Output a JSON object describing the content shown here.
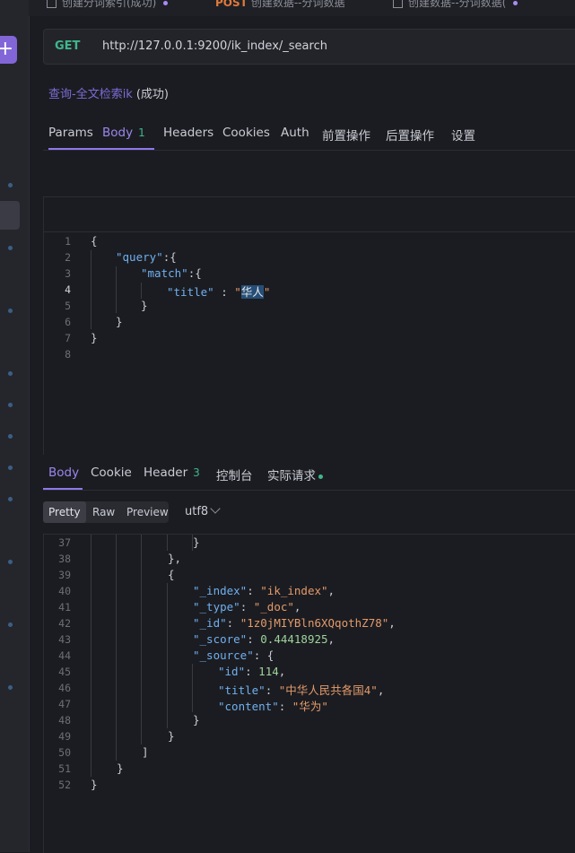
{
  "tabs": [
    {
      "method": "",
      "label": "创建分词索引(成功)",
      "dot": true
    },
    {
      "method": "POST",
      "label": "创建数据--分词数据",
      "dot": false
    },
    {
      "method": "",
      "label": "创建数据--分词数据(",
      "dot": true
    }
  ],
  "request": {
    "method": "GET",
    "url": "http://127.0.0.1:9200/ik_index/_search",
    "name": "查询-全文检索ik",
    "status": "(成功)"
  },
  "request_tabs": [
    {
      "label": "Params",
      "badge": ""
    },
    {
      "label": "Body",
      "badge": "1"
    },
    {
      "label": "Headers",
      "badge": ""
    },
    {
      "label": "Cookies",
      "badge": ""
    },
    {
      "label": "Auth",
      "badge": ""
    },
    {
      "label": "前置操作",
      "badge": ""
    },
    {
      "label": "后置操作",
      "badge": ""
    },
    {
      "label": "设置",
      "badge": ""
    }
  ],
  "body_code": {
    "line_numbers": [
      "1",
      "2",
      "3",
      "4",
      "5",
      "6",
      "7",
      "8"
    ],
    "brace_open": "{",
    "query_key": "\"query\"",
    "match_key": "\"match\"",
    "colon_brace": ":{",
    "title_key": "\"title\"",
    "sep": " : ",
    "quote": "\"",
    "title_value": "华人",
    "brace_close": "}"
  },
  "response_tabs": [
    {
      "label": "Body",
      "badge": "",
      "dot": false
    },
    {
      "label": "Cookie",
      "badge": "",
      "dot": false
    },
    {
      "label": "Header",
      "badge": "3",
      "dot": false
    },
    {
      "label": "控制台",
      "badge": "",
      "dot": false
    },
    {
      "label": "实际请求",
      "badge": "",
      "dot": true
    }
  ],
  "formats": [
    "Pretty",
    "Raw",
    "Preview"
  ],
  "encoding": "utf8",
  "response_code": {
    "line_numbers": [
      "37",
      "38",
      "39",
      "40",
      "41",
      "42",
      "43",
      "44",
      "45",
      "46",
      "47",
      "48",
      "49",
      "50",
      "51",
      "52"
    ],
    "close_brace": "}",
    "close_brace_comma": "},",
    "open_brace": "{",
    "index_key": "\"_index\"",
    "index_value": "\"ik_index\"",
    "type_key": "\"_type\"",
    "type_value": "\"_doc\"",
    "id_key": "\"_id\"",
    "id_value": "\"1z0jMIYBln6XQqothZ78\"",
    "score_key": "\"_score\"",
    "score_value": "0.44418925",
    "source_key": "\"_source\"",
    "source_open": ": {",
    "id2_key": "\"id\"",
    "id2_value": "114",
    "title_key": "\"title\"",
    "title_value": "\"中华人民共各国4\"",
    "content_key": "\"content\"",
    "content_value": "\"华为\"",
    "close_bracket": "]",
    "colon": ": ",
    "comma": ","
  },
  "colors": {
    "accent": "#8f78ea",
    "method_get": "#3fb68b",
    "method_post": "#e07a3c",
    "string": "#e39a6b",
    "key": "#6fb0f0",
    "number": "#9fd39c"
  },
  "icons": [
    "plus-icon",
    "folder-icon",
    "chevron-down-icon",
    "status-dot-icon"
  ]
}
